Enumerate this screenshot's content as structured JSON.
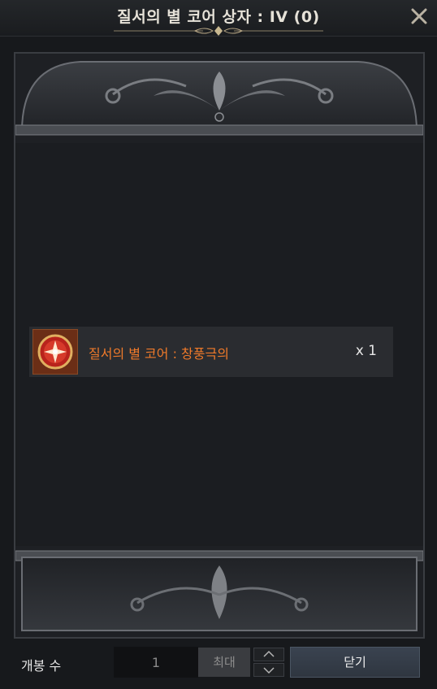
{
  "window": {
    "title": "질서의 별 코어 상자 : IV (0)",
    "close_icon": "close-icon"
  },
  "reward": {
    "item_name": "질서의 별 코어 : 창풍극의",
    "quantity_label": "x 1",
    "icon": "star-core-icon",
    "name_color": "#f07a2a"
  },
  "controls": {
    "open_count_label": "개봉 수",
    "quantity_value": "1",
    "max_label": "최대",
    "stepper_up_icon": "chevron-up-icon",
    "stepper_down_icon": "chevron-down-icon",
    "close_label": "닫기"
  },
  "colors": {
    "accent_gold": "#b9a886",
    "item_orange": "#f07a2a"
  }
}
